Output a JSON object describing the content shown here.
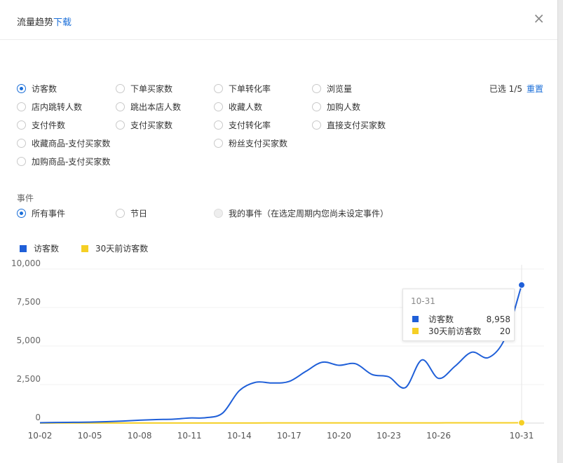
{
  "header": {
    "title": "流量趋势",
    "download": "下载",
    "close": "×"
  },
  "metrics": {
    "options": [
      {
        "label": "访客数",
        "checked": true
      },
      {
        "label": "下单买家数",
        "checked": false
      },
      {
        "label": "下单转化率",
        "checked": false
      },
      {
        "label": "浏览量",
        "checked": false
      },
      {
        "label": "店内跳转人数",
        "checked": false
      },
      {
        "label": "跳出本店人数",
        "checked": false
      },
      {
        "label": "收藏人数",
        "checked": false
      },
      {
        "label": "加购人数",
        "checked": false
      },
      {
        "label": "支付件数",
        "checked": false
      },
      {
        "label": "支付买家数",
        "checked": false
      },
      {
        "label": "支付转化率",
        "checked": false
      },
      {
        "label": "直接支付买家数",
        "checked": false
      },
      {
        "label": "收藏商品-支付买家数",
        "checked": false
      },
      {
        "label": "粉丝支付买家数",
        "checked": false
      },
      {
        "label": "加购商品-支付买家数",
        "checked": false
      }
    ],
    "selected_text": "已选 1/5",
    "reset_label": "重置"
  },
  "events": {
    "label": "事件",
    "options": [
      {
        "label": "所有事件",
        "checked": true,
        "disabled": false
      },
      {
        "label": "节日",
        "checked": false,
        "disabled": false
      },
      {
        "label": "我的事件（在选定周期内您尚未设定事件）",
        "checked": false,
        "disabled": true
      }
    ]
  },
  "legend": [
    {
      "label": "访客数",
      "color": "#1f5fd8"
    },
    {
      "label": "30天前访客数",
      "color": "#f5cf25"
    }
  ],
  "tooltip": {
    "date": "10-31",
    "rows": [
      {
        "label": "访客数",
        "value": "8,958",
        "color": "#1f5fd8"
      },
      {
        "label": "30天前访客数",
        "value": "20",
        "color": "#f5cf25"
      }
    ]
  },
  "chart_data": {
    "type": "line",
    "x": [
      "10-02",
      "10-03",
      "10-04",
      "10-05",
      "10-06",
      "10-07",
      "10-08",
      "10-09",
      "10-10",
      "10-11",
      "10-12",
      "10-13",
      "10-14",
      "10-15",
      "10-16",
      "10-17",
      "10-18",
      "10-19",
      "10-20",
      "10-21",
      "10-22",
      "10-23",
      "10-24",
      "10-25",
      "10-26",
      "10-27",
      "10-28",
      "10-29",
      "10-30",
      "10-31"
    ],
    "x_tick_labels": [
      "10-02",
      "10-05",
      "10-08",
      "10-11",
      "10-14",
      "10-17",
      "10-20",
      "10-23",
      "10-26",
      "10-31"
    ],
    "y_tick_labels": [
      "0",
      "2,500",
      "5,000",
      "7,500",
      "10,000"
    ],
    "ylim": [
      0,
      10000
    ],
    "series": [
      {
        "name": "访客数",
        "color": "#1f5fd8",
        "values": [
          20,
          40,
          50,
          60,
          90,
          130,
          190,
          230,
          250,
          330,
          350,
          650,
          2100,
          2650,
          2600,
          2700,
          3350,
          3950,
          3750,
          3850,
          3150,
          3000,
          2300,
          4100,
          2900,
          3700,
          4600,
          4250,
          5500,
          8958
        ]
      },
      {
        "name": "30天前访客数",
        "color": "#f5cf25",
        "values": [
          2,
          3,
          3,
          4,
          4,
          5,
          5,
          6,
          6,
          6,
          7,
          7,
          8,
          8,
          9,
          9,
          9,
          10,
          10,
          11,
          11,
          12,
          12,
          13,
          14,
          15,
          16,
          17,
          18,
          20
        ]
      }
    ],
    "grid": true,
    "legend_position": "top-left"
  }
}
